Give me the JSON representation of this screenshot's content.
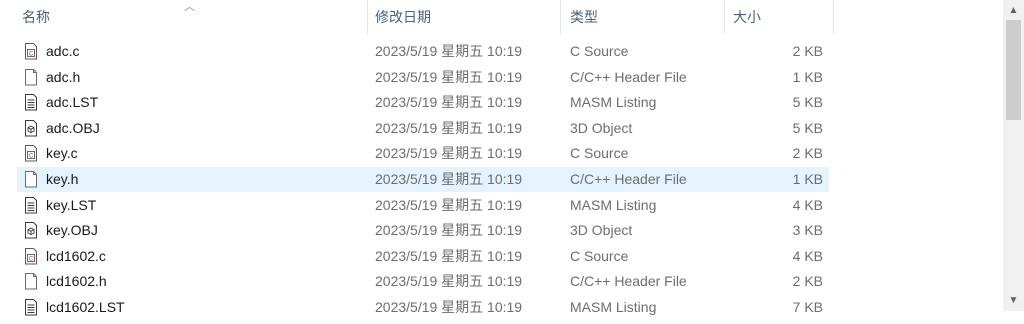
{
  "header": {
    "name": "名称",
    "date": "修改日期",
    "type": "类型",
    "size": "大小"
  },
  "files": [
    {
      "name": "adc.c",
      "date": "2023/5/19 星期五 10:19",
      "type": "C Source",
      "size": "2 KB",
      "icon": "c-source-icon"
    },
    {
      "name": "adc.h",
      "date": "2023/5/19 星期五 10:19",
      "type": "C/C++ Header File",
      "size": "1 KB",
      "icon": "header-file-icon"
    },
    {
      "name": "adc.LST",
      "date": "2023/5/19 星期五 10:19",
      "type": "MASM Listing",
      "size": "5 KB",
      "icon": "listing-file-icon"
    },
    {
      "name": "adc.OBJ",
      "date": "2023/5/19 星期五 10:19",
      "type": "3D Object",
      "size": "5 KB",
      "icon": "3d-object-icon"
    },
    {
      "name": "key.c",
      "date": "2023/5/19 星期五 10:19",
      "type": "C Source",
      "size": "2 KB",
      "icon": "c-source-icon"
    },
    {
      "name": "key.h",
      "date": "2023/5/19 星期五 10:19",
      "type": "C/C++ Header File",
      "size": "1 KB",
      "icon": "header-file-icon",
      "selected": true
    },
    {
      "name": "key.LST",
      "date": "2023/5/19 星期五 10:19",
      "type": "MASM Listing",
      "size": "4 KB",
      "icon": "listing-file-icon"
    },
    {
      "name": "key.OBJ",
      "date": "2023/5/19 星期五 10:19",
      "type": "3D Object",
      "size": "3 KB",
      "icon": "3d-object-icon"
    },
    {
      "name": "lcd1602.c",
      "date": "2023/5/19 星期五 10:19",
      "type": "C Source",
      "size": "4 KB",
      "icon": "c-source-icon"
    },
    {
      "name": "lcd1602.h",
      "date": "2023/5/19 星期五 10:19",
      "type": "C/C++ Header File",
      "size": "2 KB",
      "icon": "header-file-icon"
    },
    {
      "name": "lcd1602.LST",
      "date": "2023/5/19 星期五 10:19",
      "type": "MASM Listing",
      "size": "7 KB",
      "icon": "listing-file-icon"
    }
  ],
  "colors": {
    "header_text": "#4c607a",
    "selected_row": "#e5f3ff",
    "secondary_text": "#6d6d6d"
  }
}
